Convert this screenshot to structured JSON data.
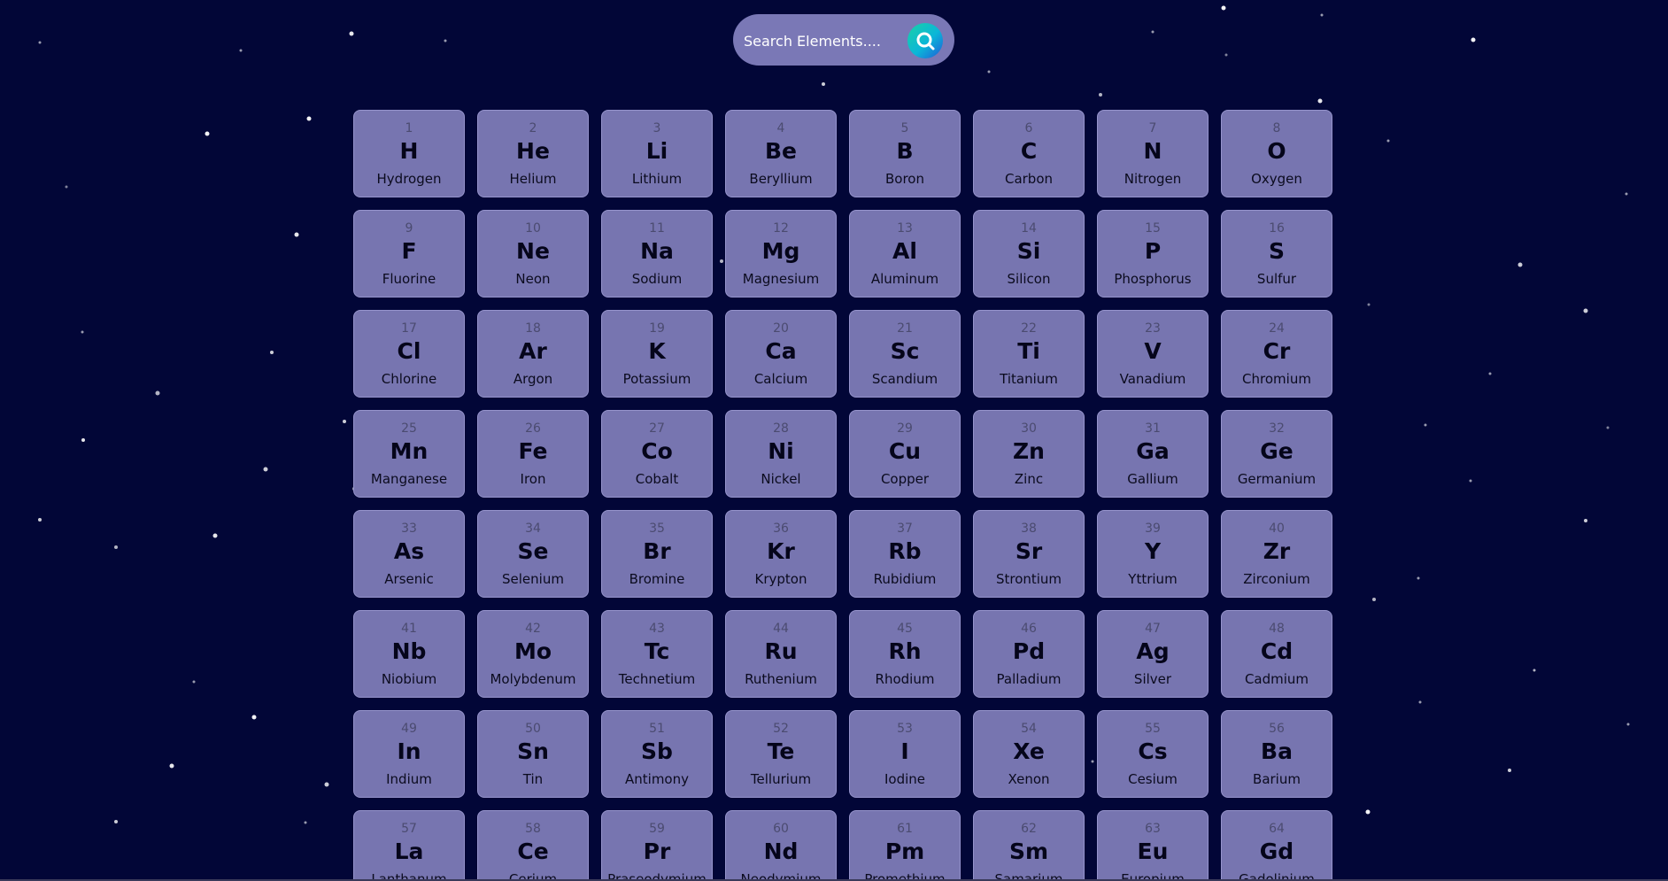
{
  "search": {
    "placeholder": "Search Elements....",
    "button_icon": "search-icon"
  },
  "colors": {
    "background": "#020637",
    "tile": "#7775b0",
    "search_bar": "#7a78b6",
    "search_button_gradient": [
      "#1ad1a5",
      "#0bb6d8",
      "#1f5bd8"
    ]
  },
  "elements": [
    {
      "number": "1",
      "symbol": "H",
      "name": "Hydrogen"
    },
    {
      "number": "2",
      "symbol": "He",
      "name": "Helium"
    },
    {
      "number": "3",
      "symbol": "Li",
      "name": "Lithium"
    },
    {
      "number": "4",
      "symbol": "Be",
      "name": "Beryllium"
    },
    {
      "number": "5",
      "symbol": "B",
      "name": "Boron"
    },
    {
      "number": "6",
      "symbol": "C",
      "name": "Carbon"
    },
    {
      "number": "7",
      "symbol": "N",
      "name": "Nitrogen"
    },
    {
      "number": "8",
      "symbol": "O",
      "name": "Oxygen"
    },
    {
      "number": "9",
      "symbol": "F",
      "name": "Fluorine"
    },
    {
      "number": "10",
      "symbol": "Ne",
      "name": "Neon"
    },
    {
      "number": "11",
      "symbol": "Na",
      "name": "Sodium"
    },
    {
      "number": "12",
      "symbol": "Mg",
      "name": "Magnesium"
    },
    {
      "number": "13",
      "symbol": "Al",
      "name": "Aluminum"
    },
    {
      "number": "14",
      "symbol": "Si",
      "name": "Silicon"
    },
    {
      "number": "15",
      "symbol": "P",
      "name": "Phosphorus"
    },
    {
      "number": "16",
      "symbol": "S",
      "name": "Sulfur"
    },
    {
      "number": "17",
      "symbol": "Cl",
      "name": "Chlorine"
    },
    {
      "number": "18",
      "symbol": "Ar",
      "name": "Argon"
    },
    {
      "number": "19",
      "symbol": "K",
      "name": "Potassium"
    },
    {
      "number": "20",
      "symbol": "Ca",
      "name": "Calcium"
    },
    {
      "number": "21",
      "symbol": "Sc",
      "name": "Scandium"
    },
    {
      "number": "22",
      "symbol": "Ti",
      "name": "Titanium"
    },
    {
      "number": "23",
      "symbol": "V",
      "name": "Vanadium"
    },
    {
      "number": "24",
      "symbol": "Cr",
      "name": "Chromium"
    },
    {
      "number": "25",
      "symbol": "Mn",
      "name": "Manganese"
    },
    {
      "number": "26",
      "symbol": "Fe",
      "name": "Iron"
    },
    {
      "number": "27",
      "symbol": "Co",
      "name": "Cobalt"
    },
    {
      "number": "28",
      "symbol": "Ni",
      "name": "Nickel"
    },
    {
      "number": "29",
      "symbol": "Cu",
      "name": "Copper"
    },
    {
      "number": "30",
      "symbol": "Zn",
      "name": "Zinc"
    },
    {
      "number": "31",
      "symbol": "Ga",
      "name": "Gallium"
    },
    {
      "number": "32",
      "symbol": "Ge",
      "name": "Germanium"
    },
    {
      "number": "33",
      "symbol": "As",
      "name": "Arsenic"
    },
    {
      "number": "34",
      "symbol": "Se",
      "name": "Selenium"
    },
    {
      "number": "35",
      "symbol": "Br",
      "name": "Bromine"
    },
    {
      "number": "36",
      "symbol": "Kr",
      "name": "Krypton"
    },
    {
      "number": "37",
      "symbol": "Rb",
      "name": "Rubidium"
    },
    {
      "number": "38",
      "symbol": "Sr",
      "name": "Strontium"
    },
    {
      "number": "39",
      "symbol": "Y",
      "name": "Yttrium"
    },
    {
      "number": "40",
      "symbol": "Zr",
      "name": "Zirconium"
    },
    {
      "number": "41",
      "symbol": "Nb",
      "name": "Niobium"
    },
    {
      "number": "42",
      "symbol": "Mo",
      "name": "Molybdenum"
    },
    {
      "number": "43",
      "symbol": "Tc",
      "name": "Technetium"
    },
    {
      "number": "44",
      "symbol": "Ru",
      "name": "Ruthenium"
    },
    {
      "number": "45",
      "symbol": "Rh",
      "name": "Rhodium"
    },
    {
      "number": "46",
      "symbol": "Pd",
      "name": "Palladium"
    },
    {
      "number": "47",
      "symbol": "Ag",
      "name": "Silver"
    },
    {
      "number": "48",
      "symbol": "Cd",
      "name": "Cadmium"
    },
    {
      "number": "49",
      "symbol": "In",
      "name": "Indium"
    },
    {
      "number": "50",
      "symbol": "Sn",
      "name": "Tin"
    },
    {
      "number": "51",
      "symbol": "Sb",
      "name": "Antimony"
    },
    {
      "number": "52",
      "symbol": "Te",
      "name": "Tellurium"
    },
    {
      "number": "53",
      "symbol": "I",
      "name": "Iodine"
    },
    {
      "number": "54",
      "symbol": "Xe",
      "name": "Xenon"
    },
    {
      "number": "55",
      "symbol": "Cs",
      "name": "Cesium"
    },
    {
      "number": "56",
      "symbol": "Ba",
      "name": "Barium"
    },
    {
      "number": "57",
      "symbol": "La",
      "name": "Lanthanum"
    },
    {
      "number": "58",
      "symbol": "Ce",
      "name": "Cerium"
    },
    {
      "number": "59",
      "symbol": "Pr",
      "name": "Praseodymium"
    },
    {
      "number": "60",
      "symbol": "Nd",
      "name": "Neodymium"
    },
    {
      "number": "61",
      "symbol": "Pm",
      "name": "Promethium"
    },
    {
      "number": "62",
      "symbol": "Sm",
      "name": "Samarium"
    },
    {
      "number": "63",
      "symbol": "Eu",
      "name": "Europium"
    },
    {
      "number": "64",
      "symbol": "Gd",
      "name": "Gadolinium"
    }
  ]
}
